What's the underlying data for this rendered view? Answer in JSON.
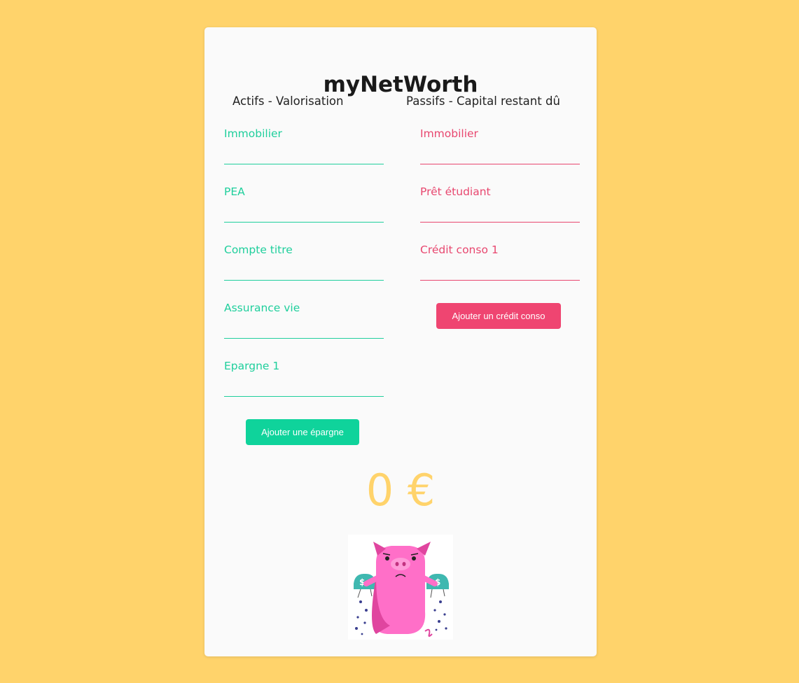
{
  "app": {
    "title": "myNetWorth"
  },
  "assets": {
    "heading": "Actifs - Valorisation",
    "fields": [
      {
        "label": "Immobilier",
        "value": ""
      },
      {
        "label": "PEA",
        "value": ""
      },
      {
        "label": "Compte titre",
        "value": ""
      },
      {
        "label": "Assurance vie",
        "value": ""
      },
      {
        "label": "Epargne 1",
        "value": ""
      }
    ],
    "add_button": "Ajouter une épargne"
  },
  "liabilities": {
    "heading": "Passifs - Capital restant dû",
    "fields": [
      {
        "label": "Immobilier",
        "value": ""
      },
      {
        "label": "Prêt étudiant",
        "value": ""
      },
      {
        "label": "Crédit conso 1",
        "value": ""
      }
    ],
    "add_button": "Ajouter un crédit conso"
  },
  "total": {
    "display": "0 €"
  },
  "colors": {
    "background": "#ffd36b",
    "assets_accent": "#1fcf9c",
    "liabilities_accent": "#e8476f",
    "assets_button": "#0fd39b",
    "liabilities_button": "#ef4571"
  },
  "image": {
    "icon": "piggy-bank-icon",
    "description_visible": false
  }
}
